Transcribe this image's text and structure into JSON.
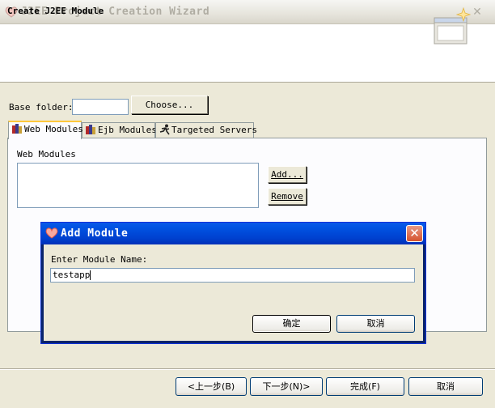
{
  "window": {
    "title": "J2EE Project Creation Wizard",
    "close_glyph": "✕",
    "header_title": "Create J2EE Module"
  },
  "form": {
    "base_folder_label": "Base folder:",
    "base_folder_value": "",
    "choose_label": "Choose..."
  },
  "tabs": [
    {
      "label": "Web Modules",
      "icon": "books-icon",
      "active": true
    },
    {
      "label": "Ejb Modules",
      "icon": "books-icon",
      "active": false
    },
    {
      "label": "Targeted Servers",
      "icon": "running-man-icon",
      "active": false
    }
  ],
  "web_modules": {
    "section_label": "Web Modules",
    "add_label": "Add...",
    "remove_label": "Remove"
  },
  "nav": {
    "back_label": "<上一步(B)",
    "next_label": "下一步(N)>",
    "finish_label": "完成(F)",
    "cancel_label": "取消"
  },
  "dialog": {
    "title": "Add Module",
    "close_glyph": "✕",
    "prompt": "Enter Module Name:",
    "value": "testapp",
    "ok_label": "确定",
    "cancel_label": "取消"
  },
  "colors": {
    "title_active": "#0054e3",
    "window_bg": "#ece9d8",
    "tab_highlight": "#ffc83c"
  }
}
